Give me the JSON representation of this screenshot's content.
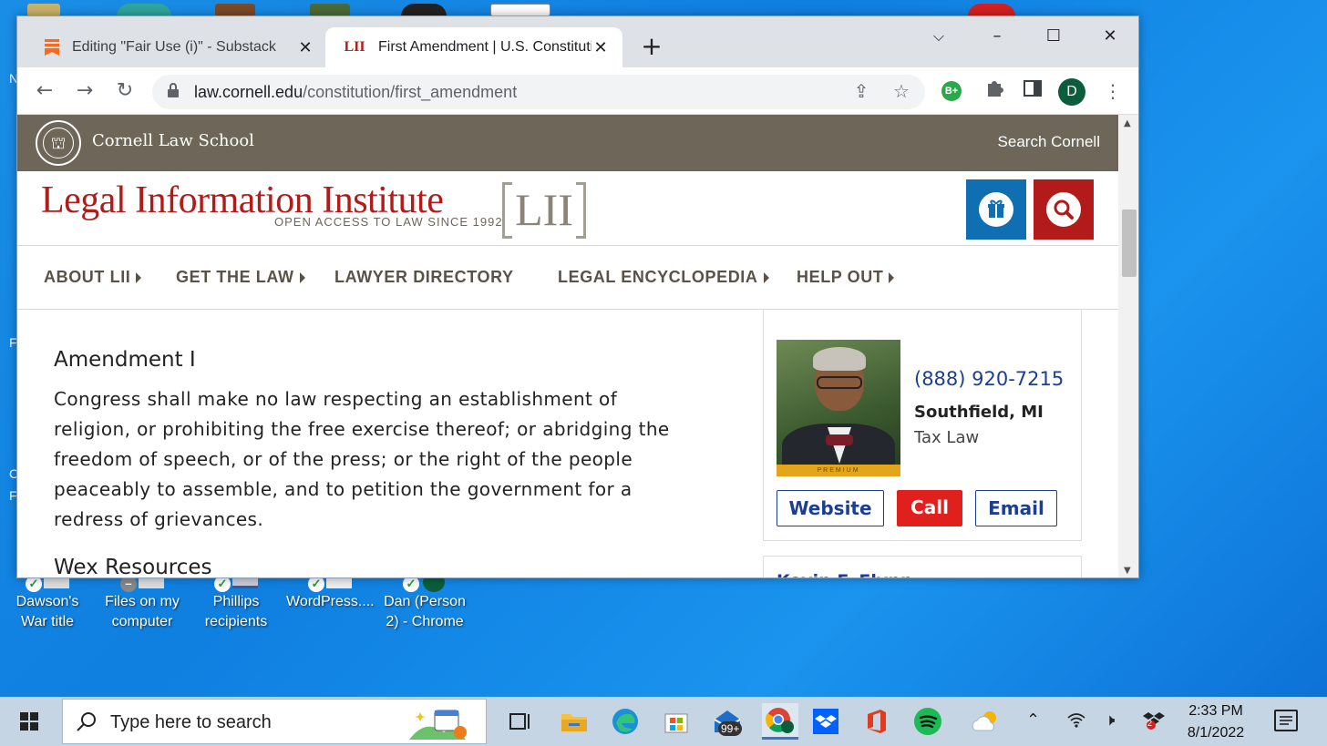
{
  "desktop": {
    "icons": [
      {
        "label": "Dawson's War title"
      },
      {
        "label": "Files on my computer"
      },
      {
        "label": "Phillips recipients"
      },
      {
        "label": "WordPress...."
      },
      {
        "label": "Dan (Person 2) - Chrome"
      }
    ]
  },
  "browser": {
    "tabs": [
      {
        "title": "Editing \"Fair Use (i)\" - Substack",
        "favicon": "substack-icon",
        "active": false
      },
      {
        "title": "First Amendment | U.S. Constitution",
        "favicon_text": "LII",
        "active": true
      }
    ],
    "new_tab": "+",
    "address": {
      "host": "law.cornell.edu",
      "path": "/constitution/first_amendment"
    },
    "extension_badge": "B+",
    "profile_initial": "D"
  },
  "page": {
    "cornell": {
      "name": "Cornell Law School",
      "search": "Search Cornell"
    },
    "lii": {
      "title": "Legal Information Institute",
      "tagline": "OPEN ACCESS TO LAW SINCE 1992",
      "mark": "LII"
    },
    "nav": [
      {
        "label": "ABOUT LII",
        "has_caret": true
      },
      {
        "label": "GET THE LAW",
        "has_caret": true
      },
      {
        "label": "LAWYER DIRECTORY",
        "has_caret": false
      },
      {
        "label": "LEGAL ENCYCLOPEDIA",
        "has_caret": true
      },
      {
        "label": "HELP OUT",
        "has_caret": true
      }
    ],
    "amendment": {
      "title": "Amendment I",
      "lines": [
        "Congress shall make no law respecting an establishment of",
        "religion, or prohibiting the free exercise thereof; or abridging the",
        "freedom of speech, or of the press; or the right of the people",
        "peaceably to assemble, and to petition the government for a",
        "redress of grievances."
      ]
    },
    "wex_heading": "Wex Resources",
    "lawyer": {
      "badge": "PREMIUM",
      "phone": "(888) 920-7215",
      "city": "Southfield, MI",
      "practice": "Tax Law",
      "buttons": {
        "website": "Website",
        "call": "Call",
        "email": "Email"
      }
    },
    "next_lawyer_name": "Kevin F. Flynn"
  },
  "taskbar": {
    "search_placeholder": "Type here to search",
    "mail_badge": "99+",
    "time": "2:33 PM",
    "date": "8/1/2022",
    "dropbox_badge": "2"
  },
  "colors": {
    "cornell_brown": "#6e6759",
    "lii_red": "#b31b1b",
    "gift_blue": "#0f6fb2",
    "link_blue": "#1c3f94",
    "call_red": "#e0201d",
    "premium_gold": "#e3a51a"
  }
}
